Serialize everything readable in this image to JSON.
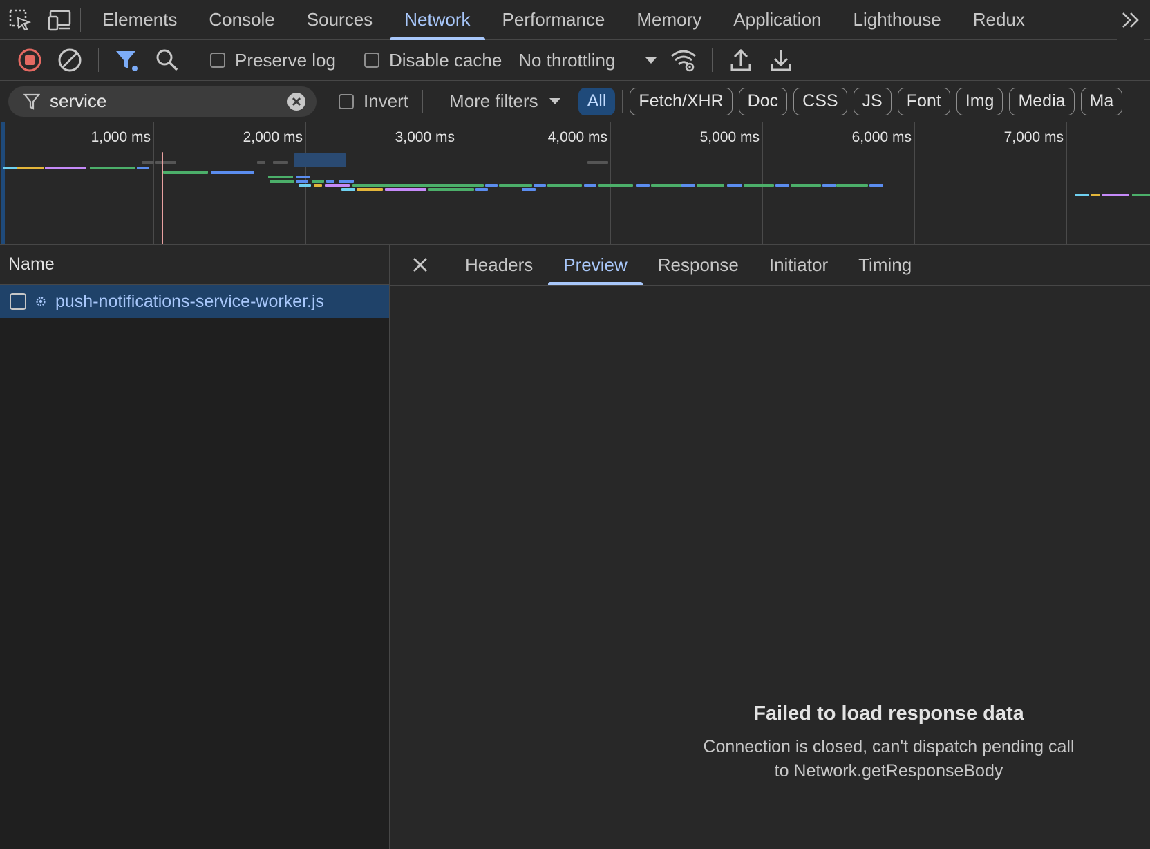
{
  "panel_tabs": [
    "Elements",
    "Console",
    "Sources",
    "Network",
    "Performance",
    "Memory",
    "Application",
    "Lighthouse",
    "Redux"
  ],
  "active_panel_tab": "Network",
  "toolbar": {
    "preserve_log_label": "Preserve log",
    "disable_cache_label": "Disable cache",
    "throttling_value": "No throttling"
  },
  "filter": {
    "value": "service",
    "invert_label": "Invert",
    "more_filters_label": "More filters",
    "type_chips": [
      "All",
      "Fetch/XHR",
      "Doc",
      "CSS",
      "JS",
      "Font",
      "Img",
      "Media",
      "Ma"
    ],
    "active_chip": "All"
  },
  "overview": {
    "tick_labels": [
      "1,000 ms",
      "2,000 ms",
      "3,000 ms",
      "4,000 ms",
      "5,000 ms",
      "6,000 ms",
      "7,000 ms"
    ]
  },
  "requests": {
    "column_header": "Name",
    "rows": [
      {
        "name": "push-notifications-service-worker.js",
        "icon": "gear-icon",
        "selected": true
      }
    ]
  },
  "detail": {
    "tabs": [
      "Headers",
      "Preview",
      "Response",
      "Initiator",
      "Timing"
    ],
    "active_tab": "Preview",
    "error_title": "Failed to load response data",
    "error_body": "Connection is closed, can't dispatch pending call to Network.getResponseBody"
  },
  "colors": {
    "accent": "#a8c7fa",
    "selected_row": "#1f4269",
    "record_red": "#e46962"
  }
}
